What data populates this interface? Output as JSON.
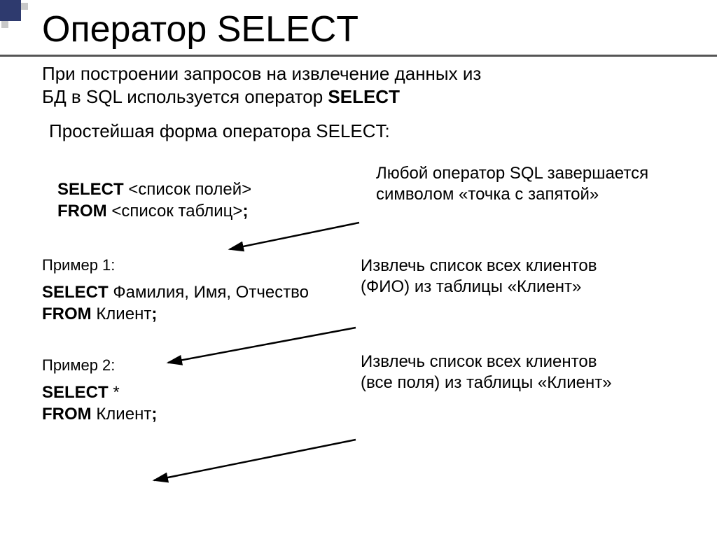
{
  "title": "Оператор SELECT",
  "intro_l1": "При построении запросов на извлечение данных из",
  "intro_l2": "БД в SQL используется оператор ",
  "intro_bold": "SELECT",
  "subhead": "Простейшая форма оператора SELECT:",
  "syntax": {
    "select_kw": "SELECT",
    "select_rest": " <список полей>",
    "from_kw": "FROM",
    "from_rest": " <список таблиц>",
    "semicolon": ";"
  },
  "note1_l1": "Любой оператор SQL завершается",
  "note1_l2": "символом «точка с запятой»",
  "ex1_label": "Пример 1:",
  "ex1": {
    "select_kw": "SELECT",
    "select_rest": " Фамилия, Имя, Отчество",
    "from_kw": "FROM",
    "from_rest": " Клиент",
    "semicolon": ";"
  },
  "note2_l1": "Извлечь список всех клиентов",
  "note2_l2": "(ФИО) из таблицы «Клиент»",
  "ex2_label": "Пример 2:",
  "ex2": {
    "select_kw": "SELECT",
    "select_rest": " *",
    "from_kw": "FROM",
    "from_rest": " Клиент",
    "semicolon": ";"
  },
  "note3_l1": "Извлечь список всех клиентов",
  "note3_l2": "(все поля) из таблицы «Клиент»"
}
